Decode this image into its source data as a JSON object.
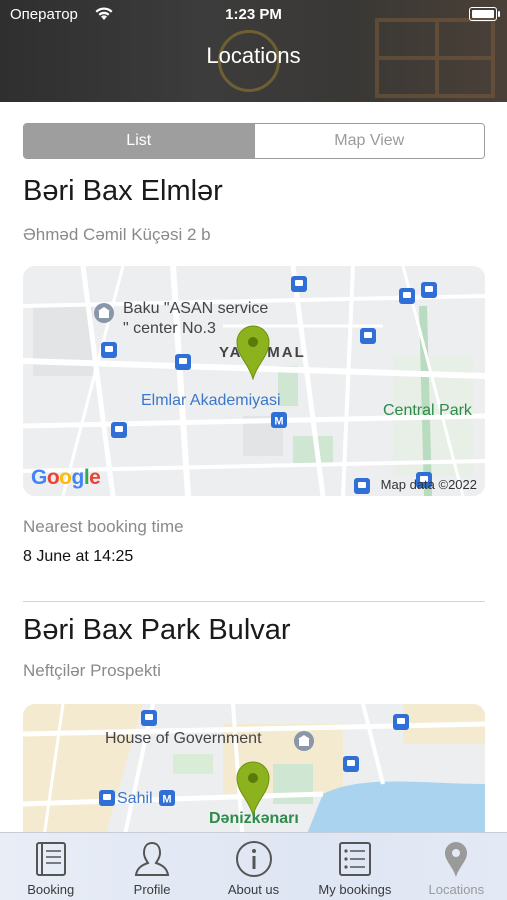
{
  "status_bar": {
    "carrier": "Оператор",
    "time": "1:23 PM"
  },
  "header": {
    "title": "Locations"
  },
  "segmented": {
    "list_label": "List",
    "map_label": "Map View",
    "selected": "List"
  },
  "locations": [
    {
      "name": "Bəri Bax Elmlər",
      "address": "Əhməd Cəmil Küçəsi 2 b",
      "map": {
        "labels": [
          "Baku \"ASAN service",
          "\" center No.3",
          "YASAMAL",
          "Elmlar Akademiyasi",
          "Central Park"
        ],
        "google": "Google",
        "map_data": "Map data ©2022"
      },
      "nearest_label": "Nearest booking time",
      "nearest_value": "8 June at 14:25"
    },
    {
      "name": "Bəri Bax Park Bulvar",
      "address": "Neftçilər Prospekti",
      "map": {
        "labels": [
          "House of Government",
          "Sahil",
          "Dənizkənarı"
        ]
      }
    }
  ],
  "tabbar": {
    "items": [
      {
        "label": "Booking",
        "icon": "book-icon"
      },
      {
        "label": "Profile",
        "icon": "person-icon"
      },
      {
        "label": "About us",
        "icon": "info-icon"
      },
      {
        "label": "My bookings",
        "icon": "list-icon"
      },
      {
        "label": "Locations",
        "icon": "location-pin-icon"
      }
    ],
    "selected": "Locations"
  },
  "colors": {
    "pin": "#8cb21d",
    "transit": "#2f6fd6",
    "selected_tab": "#9a9a9a",
    "segment_active": "#9e9e9e"
  }
}
